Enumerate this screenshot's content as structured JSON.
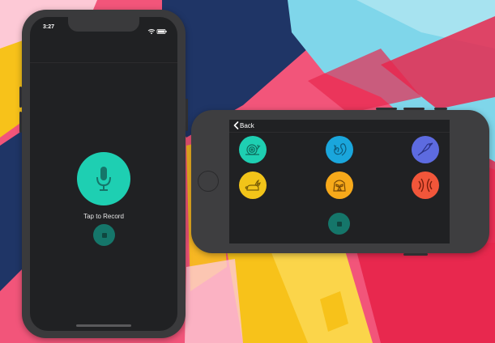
{
  "wallpaper": {
    "colors": {
      "pink": "#f2557a",
      "navy": "#1f3566",
      "sky": "#7fd6ea",
      "yellow": "#f7c21a",
      "red": "#e8284e",
      "light_pink": "#fdc9d6"
    }
  },
  "portrait_phone": {
    "status_bar": {
      "time": "3:27",
      "icons": [
        "wifi-icon",
        "battery-icon"
      ]
    },
    "record_button": {
      "icon": "microphone-icon",
      "color": "#1ecfb2"
    },
    "record_label": "Tap to Record",
    "stop_button": {
      "icon": "stop-icon",
      "color": "#15766a"
    }
  },
  "landscape_phone": {
    "nav": {
      "back_label": "Back",
      "back_icon": "chevron-left-icon"
    },
    "sound_buttons": [
      {
        "name": "snail",
        "icon": "snail-icon",
        "color": "#1ecfb2"
      },
      {
        "name": "squirrel",
        "icon": "squirrel-icon",
        "color": "#1aa6dc"
      },
      {
        "name": "bird",
        "icon": "bird-icon",
        "color": "#5d6be0"
      },
      {
        "name": "rabbit",
        "icon": "rabbit-icon",
        "color": "#f2c419"
      },
      {
        "name": "vader",
        "icon": "vader-icon",
        "color": "#f7a91a"
      },
      {
        "name": "echo",
        "icon": "echo-icon",
        "color": "#f2563a"
      }
    ],
    "stop_button": {
      "icon": "stop-icon",
      "color": "#15766a"
    }
  }
}
